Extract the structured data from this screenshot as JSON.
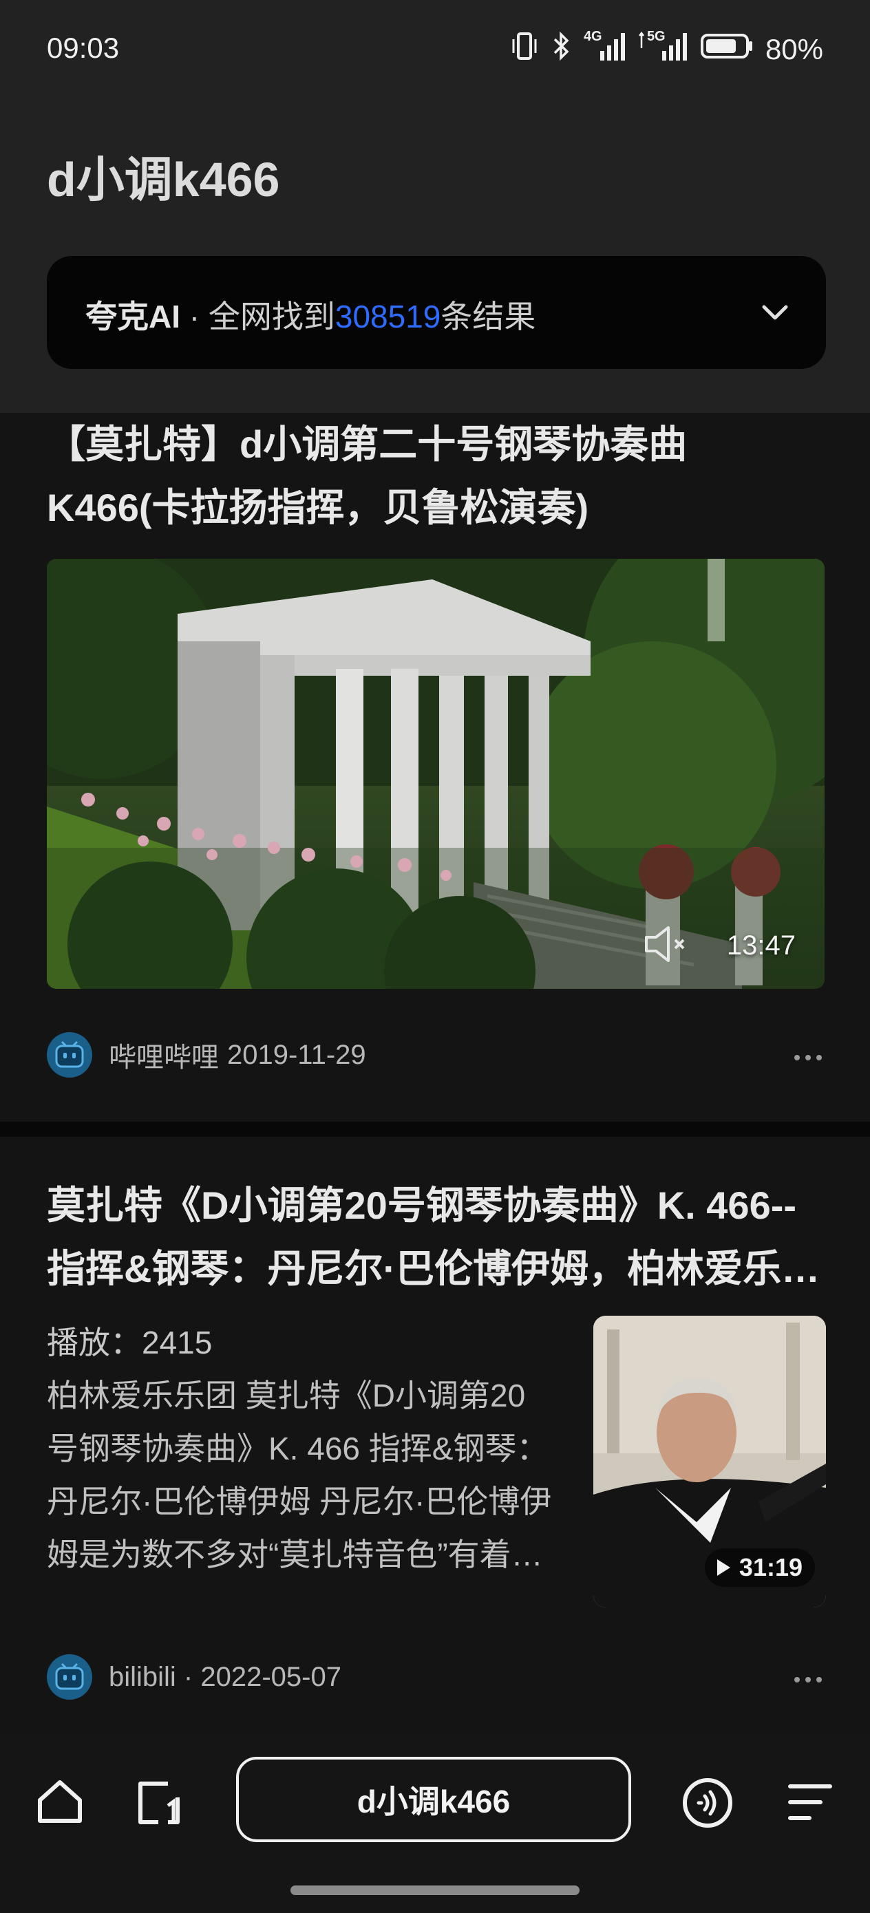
{
  "status_bar": {
    "time": "09:03",
    "network_4g": "4G",
    "network_5g": "5G",
    "battery_percent": "80%",
    "battery_level": 0.8,
    "icons": [
      "vibrate-icon",
      "bluetooth-icon",
      "signal-4g-icon",
      "signal-5g-icon",
      "battery-icon"
    ]
  },
  "header": {
    "title": "d小调k466",
    "ai_bar": {
      "brand": "夸克AI",
      "separator": " · ",
      "prefix": "全网找到",
      "count": "308519",
      "suffix": "条结果",
      "accent_color": "#2e6bff",
      "icon": "chevron-down-icon"
    }
  },
  "results": [
    {
      "title": "【莫扎特】d小调第二十号钢琴协奏曲 K466(卡拉扬指挥，贝鲁松演奏)",
      "duration": "13:47",
      "source": "哔哩哔哩",
      "date": "2019-11-29",
      "icons": [
        "mute-icon",
        "more-icon"
      ]
    },
    {
      "title": "莫扎特《D小调第20号钢琴协奏曲》K. 466--指挥&钢琴：丹尼尔·巴伦博伊姆，柏林爱乐乐团",
      "plays": "播放：2415",
      "description": "柏林爱乐乐团 莫扎特《D小调第20号钢琴协奏曲》K. 466 指挥&钢琴：丹尼尔·巴伦博伊姆 丹尼尔·巴伦博伊姆是为数不多对“莫扎特音色”有着极高敏锐度的钢琴家之一",
      "duration": "31:19",
      "source": "bilibili",
      "date_line": "bilibili · 2022-05-07",
      "icons": [
        "play-icon",
        "more-icon"
      ]
    }
  ],
  "bottom_nav": {
    "search_text": "d小调k466",
    "icons": [
      "home-icon",
      "tabs-icon",
      "voice-icon",
      "menu-icon"
    ]
  }
}
